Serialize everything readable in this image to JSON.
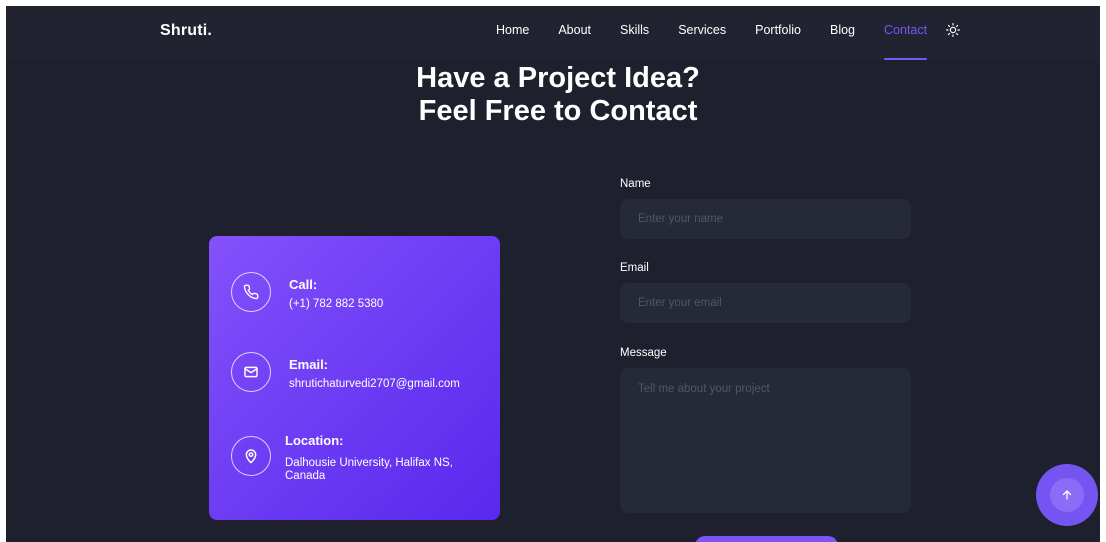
{
  "brand": {
    "logo": "Shruti."
  },
  "nav": {
    "items": [
      {
        "label": "Home"
      },
      {
        "label": "About"
      },
      {
        "label": "Skills"
      },
      {
        "label": "Services"
      },
      {
        "label": "Portfolio"
      },
      {
        "label": "Blog"
      },
      {
        "label": "Contact"
      }
    ],
    "active": "Contact",
    "theme_toggle_icon": "sun-icon"
  },
  "heading": {
    "line1": "Have a Project Idea?",
    "line2": "Feel Free to Contact"
  },
  "contact_card": {
    "call": {
      "icon": "phone-icon",
      "title": "Call:",
      "value": "(+1) 782 882 5380"
    },
    "email": {
      "icon": "mail-icon",
      "title": "Email:",
      "value": "shrutichaturvedi2707@gmail.com"
    },
    "location": {
      "icon": "location-pin-icon",
      "title": "Location:",
      "value": "Dalhousie University, Halifax NS, Canada"
    }
  },
  "form": {
    "name": {
      "label": "Name",
      "placeholder": "Enter your name",
      "value": ""
    },
    "email": {
      "label": "Email",
      "placeholder": "Enter your email",
      "value": ""
    },
    "message": {
      "label": "Message",
      "placeholder": "Tell me about your project",
      "value": ""
    }
  },
  "back_to_top": {
    "icon": "arrow-up-icon"
  },
  "colors": {
    "accent": "#7b55f5",
    "background": "#1e212d",
    "nav_background": "#212430",
    "input_background": "#262a37",
    "card_gradient_start": "#8451fb",
    "card_gradient_end": "#5a28ee"
  }
}
